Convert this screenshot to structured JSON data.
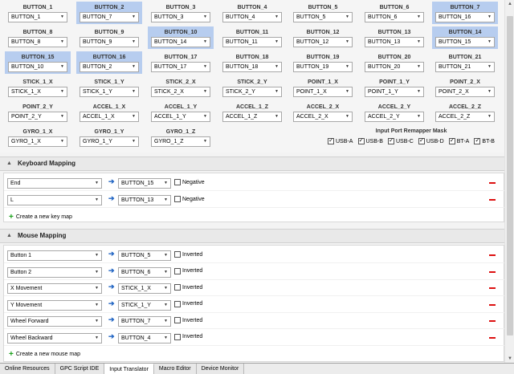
{
  "grid": [
    {
      "label": "BUTTON_1",
      "value": "BUTTON_1",
      "selected": false
    },
    {
      "label": "BUTTON_2",
      "value": "BUTTON_7",
      "selected": true
    },
    {
      "label": "BUTTON_3",
      "value": "BUTTON_3",
      "selected": false
    },
    {
      "label": "BUTTON_4",
      "value": "BUTTON_4",
      "selected": false
    },
    {
      "label": "BUTTON_5",
      "value": "BUTTON_5",
      "selected": false
    },
    {
      "label": "BUTTON_6",
      "value": "BUTTON_6",
      "selected": false
    },
    {
      "label": "BUTTON_7",
      "value": "BUTTON_16",
      "selected": true
    },
    {
      "label": "BUTTON_8",
      "value": "BUTTON_8",
      "selected": false
    },
    {
      "label": "BUTTON_9",
      "value": "BUTTON_9",
      "selected": false
    },
    {
      "label": "BUTTON_10",
      "value": "BUTTON_14",
      "selected": true
    },
    {
      "label": "BUTTON_11",
      "value": "BUTTON_11",
      "selected": false
    },
    {
      "label": "BUTTON_12",
      "value": "BUTTON_12",
      "selected": false
    },
    {
      "label": "BUTTON_13",
      "value": "BUTTON_13",
      "selected": false
    },
    {
      "label": "BUTTON_14",
      "value": "BUTTON_15",
      "selected": true
    },
    {
      "label": "BUTTON_15",
      "value": "BUTTON_10",
      "selected": true
    },
    {
      "label": "BUTTON_16",
      "value": "BUTTON_2",
      "selected": true
    },
    {
      "label": "BUTTON_17",
      "value": "BUTTON_17",
      "selected": false
    },
    {
      "label": "BUTTON_18",
      "value": "BUTTON_18",
      "selected": false
    },
    {
      "label": "BUTTON_19",
      "value": "BUTTON_19",
      "selected": false
    },
    {
      "label": "BUTTON_20",
      "value": "BUTTON_20",
      "selected": false
    },
    {
      "label": "BUTTON_21",
      "value": "BUTTON_21",
      "selected": false
    },
    {
      "label": "STICK_1_X",
      "value": "STICK_1_X",
      "selected": false
    },
    {
      "label": "STICK_1_Y",
      "value": "STICK_1_Y",
      "selected": false
    },
    {
      "label": "STICK_2_X",
      "value": "STICK_2_X",
      "selected": false
    },
    {
      "label": "STICK_2_Y",
      "value": "STICK_2_Y",
      "selected": false
    },
    {
      "label": "POINT_1_X",
      "value": "POINT_1_X",
      "selected": false
    },
    {
      "label": "POINT_1_Y",
      "value": "POINT_1_Y",
      "selected": false
    },
    {
      "label": "POINT_2_X",
      "value": "POINT_2_X",
      "selected": false
    },
    {
      "label": "POINT_2_Y",
      "value": "POINT_2_Y",
      "selected": false
    },
    {
      "label": "ACCEL_1_X",
      "value": "ACCEL_1_X",
      "selected": false
    },
    {
      "label": "ACCEL_1_Y",
      "value": "ACCEL_1_Y",
      "selected": false
    },
    {
      "label": "ACCEL_1_Z",
      "value": "ACCEL_1_Z",
      "selected": false
    },
    {
      "label": "ACCEL_2_X",
      "value": "ACCEL_2_X",
      "selected": false
    },
    {
      "label": "ACCEL_2_Y",
      "value": "ACCEL_2_Y",
      "selected": false
    },
    {
      "label": "ACCEL_2_Z",
      "value": "ACCEL_2_Z",
      "selected": false
    },
    {
      "label": "GYRO_1_X",
      "value": "GYRO_1_X",
      "selected": false
    },
    {
      "label": "GYRO_1_Y",
      "value": "GYRO_1_Y",
      "selected": false
    },
    {
      "label": "GYRO_1_Z",
      "value": "GYRO_1_Z",
      "selected": false
    }
  ],
  "mask": {
    "title": "Input Port Remapper Mask",
    "options": [
      {
        "label": "USB-A",
        "checked": true
      },
      {
        "label": "USB-B",
        "checked": true
      },
      {
        "label": "USB-C",
        "checked": true
      },
      {
        "label": "USB-D",
        "checked": true
      },
      {
        "label": "BT-A",
        "checked": true
      },
      {
        "label": "BT-B",
        "checked": true
      }
    ]
  },
  "keyboard": {
    "title": "Keyboard Mapping",
    "rows": [
      {
        "source": "End",
        "target": "BUTTON_15",
        "flag_label": "Negative",
        "flag": false
      },
      {
        "source": "L",
        "target": "BUTTON_13",
        "flag_label": "Negative",
        "flag": false
      }
    ],
    "create_label": "Create a new key map"
  },
  "mouse": {
    "title": "Mouse Mapping",
    "rows": [
      {
        "source": "Button 1",
        "target": "BUTTON_5",
        "flag_label": "Inverted",
        "flag": false
      },
      {
        "source": "Button 2",
        "target": "BUTTON_6",
        "flag_label": "Inverted",
        "flag": false
      },
      {
        "source": "X Movement",
        "target": "STICK_1_X",
        "flag_label": "Inverted",
        "flag": false
      },
      {
        "source": "Y Movement",
        "target": "STICK_1_Y",
        "flag_label": "Inverted",
        "flag": false
      },
      {
        "source": "Wheel Forward",
        "target": "BUTTON_7",
        "flag_label": "Inverted",
        "flag": false
      },
      {
        "source": "Wheel Backward",
        "target": "BUTTON_4",
        "flag_label": "Inverted",
        "flag": false
      }
    ],
    "create_label": "Create a new mouse map"
  },
  "tabs": [
    {
      "label": "Online Resources",
      "active": false
    },
    {
      "label": "GPC Script IDE",
      "active": false
    },
    {
      "label": "Input Translator",
      "active": true
    },
    {
      "label": "Macro Editor",
      "active": false
    },
    {
      "label": "Device Monitor",
      "active": false
    }
  ],
  "colors": {
    "selected": "#b7cdef",
    "arrow": "#1d62c2",
    "delete": "#dd1111",
    "plus": "#1aa01a"
  }
}
